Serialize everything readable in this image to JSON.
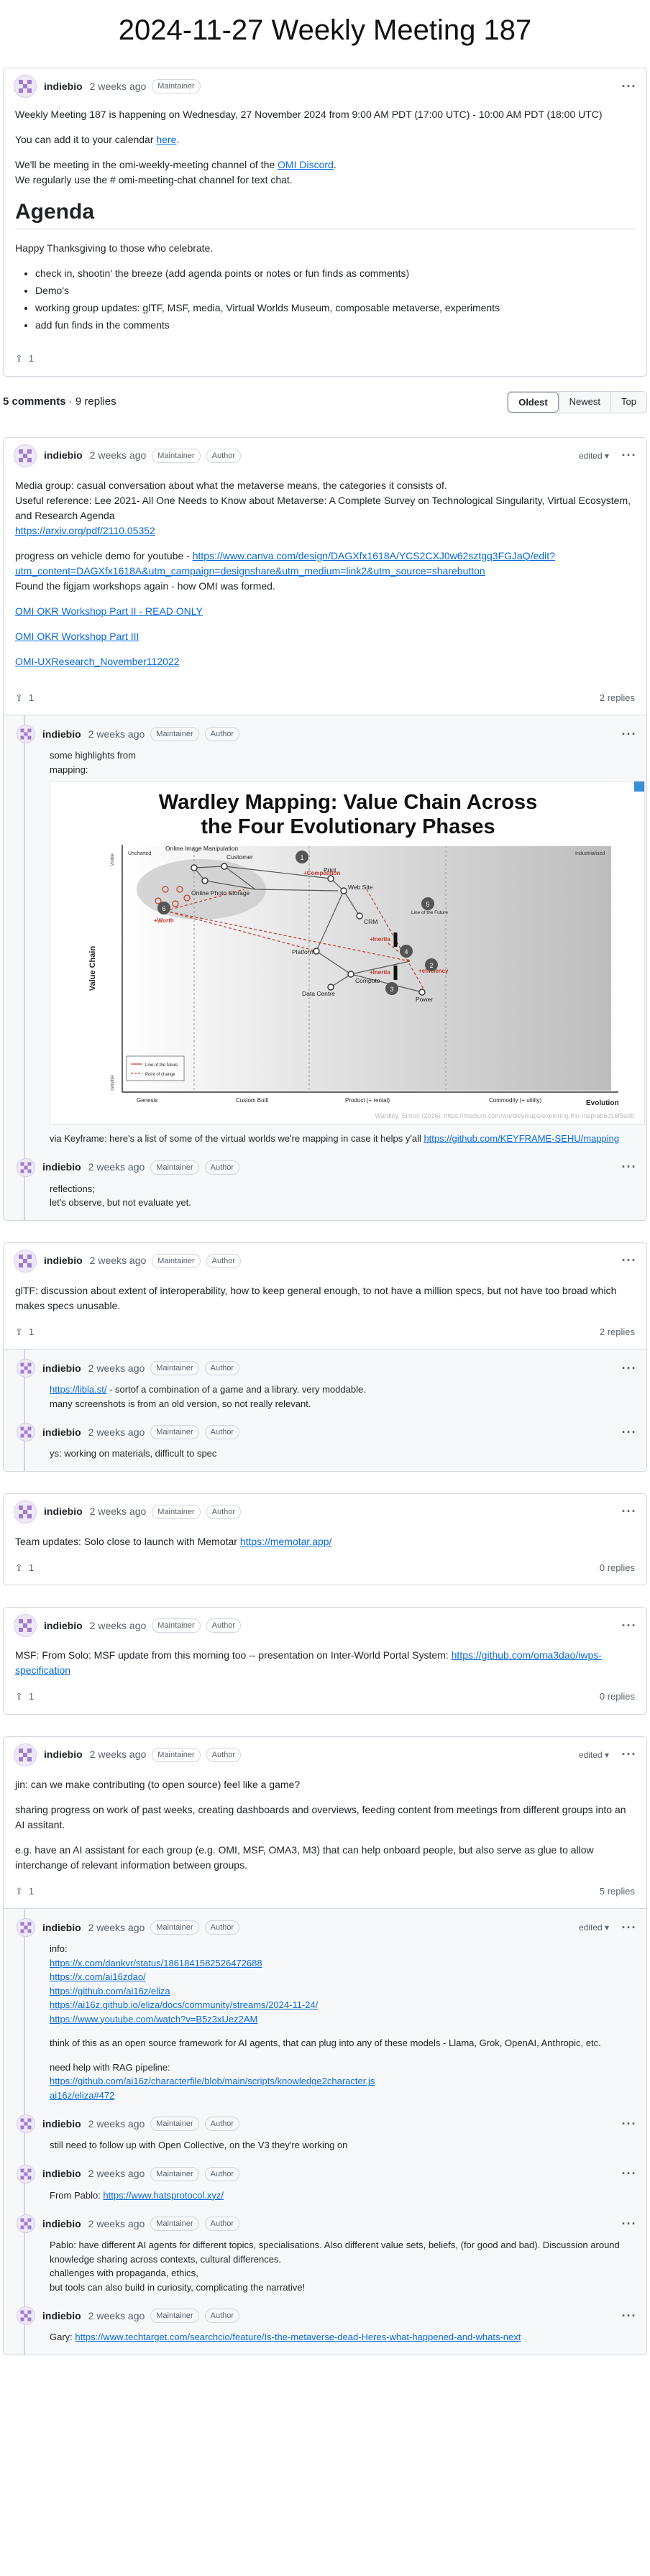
{
  "page": {
    "title": "2024-11-27 Weekly Meeting 187"
  },
  "post": {
    "author": "indiebio",
    "ago": "2 weeks ago",
    "badges": [
      "Maintainer"
    ],
    "p1": "Weekly Meeting 187 is happening on Wednesday, 27 November 2024 from 9:00 AM PDT (17:00 UTC) - 10:00 AM PDT (18:00 UTC)",
    "p2_pre": "You can add it to your calendar ",
    "p2_link": "here",
    "p2_post": ".",
    "p3a_pre": "We'll be meeting in the omi-weekly-meeting channel of the ",
    "p3a_link": "OMI Discord",
    "p3a_post": ".",
    "p3b": "We regularly use the # omi-meeting-chat channel for text chat.",
    "agenda_heading": "Agenda",
    "p4": "Happy Thanksgiving to those who celebrate.",
    "agenda_items": [
      "check in, shootin' the breeze (add agenda points or notes or fun finds as comments)",
      "Demo's",
      "working group updates: glTF, MSF, media, Virtual Worlds Museum, composable metaverse, experiments",
      "add fun finds in the comments"
    ],
    "upvotes": "1"
  },
  "comments_bar": {
    "count": "5 comments",
    "replies": "· 9 replies",
    "sort": [
      "Oldest",
      "Newest",
      "Top"
    ]
  },
  "common": {
    "author": "indiebio",
    "ago": "2 weeks ago",
    "maintainer": "Maintainer",
    "author_badge": "Author",
    "edited": "edited ▾",
    "kebab": "···"
  },
  "threads": [
    {
      "edited": true,
      "lines": [
        {
          "t": "Media group: casual conversation about what the metaverse means, the categories it consists of."
        },
        {
          "t": "Useful reference: Lee 2021- All One Needs to Know about Metaverse: A Complete Survey on Technological Singularity, Virtual Ecosystem, and Research Agenda"
        },
        {
          "link": "https://arxiv.org/pdf/2110.05352",
          "gap": true
        },
        {
          "t": "progress on vehicle demo for youtube - ",
          "link": "https://www.canva.com/design/DAGXfx1618A/YCS2CXJ0w62sztgq3FGJaQ/edit?utm_content=DAGXfx1618A&utm_campaign=designshare&utm_medium=link2&utm_source=sharebutton"
        },
        {
          "t": "Found the figjam workshops again - how OMI was formed.",
          "gap": true
        },
        {
          "link": "OMI OKR Workshop Part II - READ ONLY",
          "gap": true
        },
        {
          "link": "OMI OKR Workshop Part III",
          "gap": true
        },
        {
          "link": "OMI-UXResearch_November112022",
          "gap": true
        }
      ],
      "upvotes": "1",
      "replies_label": "2 replies",
      "replies": [
        {
          "edited": false,
          "has_image": true,
          "lines": [
            {
              "t": "some highlights from"
            },
            {
              "t": "mapping:"
            }
          ],
          "after": [
            {
              "t": "via Keyframe: here's a list of some of the virtual worlds we're mapping in case it helps y'all ",
              "link": "https://github.com/KEYFRAME-SEHU/mapping"
            }
          ]
        },
        {
          "edited": false,
          "lines": [
            {
              "t": "reflections;"
            },
            {
              "t": "let's observe, but not evaluate yet."
            }
          ]
        }
      ]
    },
    {
      "edited": false,
      "lines": [
        {
          "t": "glTF: discussion about extent of interoperability, how to keep general enough, to not have a million specs, but not have too broad which makes specs unusable."
        }
      ],
      "upvotes": "1",
      "replies_label": "2 replies",
      "replies": [
        {
          "edited": false,
          "lines": [
            {
              "link": "https://libla.st/",
              "t2": " - sortof a combination of a game and a library. very moddable."
            },
            {
              "t": "many screenshots is from an old version, so not really relevant."
            }
          ]
        },
        {
          "edited": false,
          "lines": [
            {
              "t": "ys: working on materials, difficult to spec"
            }
          ]
        }
      ]
    },
    {
      "edited": false,
      "lines": [
        {
          "t": "Team updates: Solo close to launch with Memotar ",
          "link": "https://memotar.app/"
        }
      ],
      "upvotes": "1",
      "replies_label": "0 replies",
      "replies": []
    },
    {
      "edited": false,
      "lines": [
        {
          "t": "MSF: From Solo: MSF update from this morning too -- presentation on Inter-World Portal System: ",
          "link": "https://github.com/oma3dao/iwps-specification"
        }
      ],
      "upvotes": "1",
      "replies_label": "0 replies",
      "replies": []
    },
    {
      "edited": true,
      "lines": [
        {
          "t": "jin: can we make contributing (to open source) feel like a game?",
          "gap": true
        },
        {
          "t": "sharing progress on work of past weeks, creating dashboards and overviews, feeding content from meetings from different groups into an AI assitant.",
          "gap": true
        },
        {
          "t": "e.g. have an AI assistant for each group (e.g. OMI, MSF, OMA3, M3) that can help onboard people, but also serve as glue to allow interchange of relevant information between groups."
        }
      ],
      "upvotes": "1",
      "replies_label": "5 replies",
      "replies": [
        {
          "edited": true,
          "lines": [
            {
              "t": "info:"
            },
            {
              "link": "https://x.com/dankvr/status/1861841582526472688"
            },
            {
              "link": "https://x.com/ai16zdao/"
            },
            {
              "link": "https://github.com/ai16z/eliza"
            },
            {
              "link": "https://ai16z.github.io/eliza/docs/community/streams/2024-11-24/"
            },
            {
              "link": "https://www.youtube.com/watch?v=B5z3xUez2AM",
              "gap": true
            },
            {
              "t": "think of this as an open source framework for AI agents, that can plug into any of these models - Llama, Grok, OpenAI, Anthropic, etc.",
              "gap": true
            },
            {
              "t": "need help with RAG pipeline:"
            },
            {
              "link": "https://github.com/ai16z/characterfile/blob/main/scripts/knowledge2character.js"
            },
            {
              "link": "ai16z/eliza#472"
            }
          ]
        },
        {
          "edited": false,
          "lines": [
            {
              "t": "still need to follow up with Open Collective, on the V3 they're working on"
            }
          ]
        },
        {
          "edited": false,
          "lines": [
            {
              "t": "From Pablo: ",
              "link": "https://www.hatsprotocol.xyz/"
            }
          ]
        },
        {
          "edited": false,
          "lines": [
            {
              "t": "Pablo: have different AI agents for different topics, specialisations. Also different value sets, beliefs, (for good and bad). Discussion around knowledge sharing across contexts, cultural differences."
            },
            {
              "t": "challenges with propaganda, ethics,"
            },
            {
              "t": "but tools can also build in curiosity, complicating the narrative!"
            }
          ]
        },
        {
          "edited": false,
          "lines": [
            {
              "t": "Gary: ",
              "link": "https://www.techtarget.com/searchcio/feature/Is-the-metaverse-dead-Heres-what-happened-and-whats-next"
            }
          ]
        }
      ]
    }
  ],
  "wardley": {
    "title_l1": "Wardley Mapping: Value Chain Across",
    "title_l2": "the Four Evolutionary Phases",
    "y_axis": "Value Chain",
    "y_top": "Visible",
    "y_bottom": "Invisible",
    "x_axis": "Evolution",
    "phases": [
      "Genesis",
      "Custom Built",
      "Product (+ rental)",
      "Commodity (+ utility)"
    ],
    "zones": [
      "Uncharted",
      "Industrialised"
    ],
    "nodes": [
      "Online Image Manipulation",
      "Customer",
      "Print",
      "Online Photo Storage",
      "Web Site",
      "CRM",
      "Platform",
      "Compute",
      "Data Centre",
      "Power"
    ],
    "tags": [
      "+Competition",
      "+Worth",
      "+Inertia",
      "+Inertia",
      "+efficiency",
      "Line of the Future"
    ],
    "markers": [
      "1",
      "2",
      "3",
      "4",
      "5",
      "6"
    ],
    "legend": [
      "Line of the future",
      "Point of change"
    ],
    "caption": "Wardley, Simon (2016): https://medium.com/wardleymaps/exploring-the-map-ab6d16f9a9b"
  }
}
